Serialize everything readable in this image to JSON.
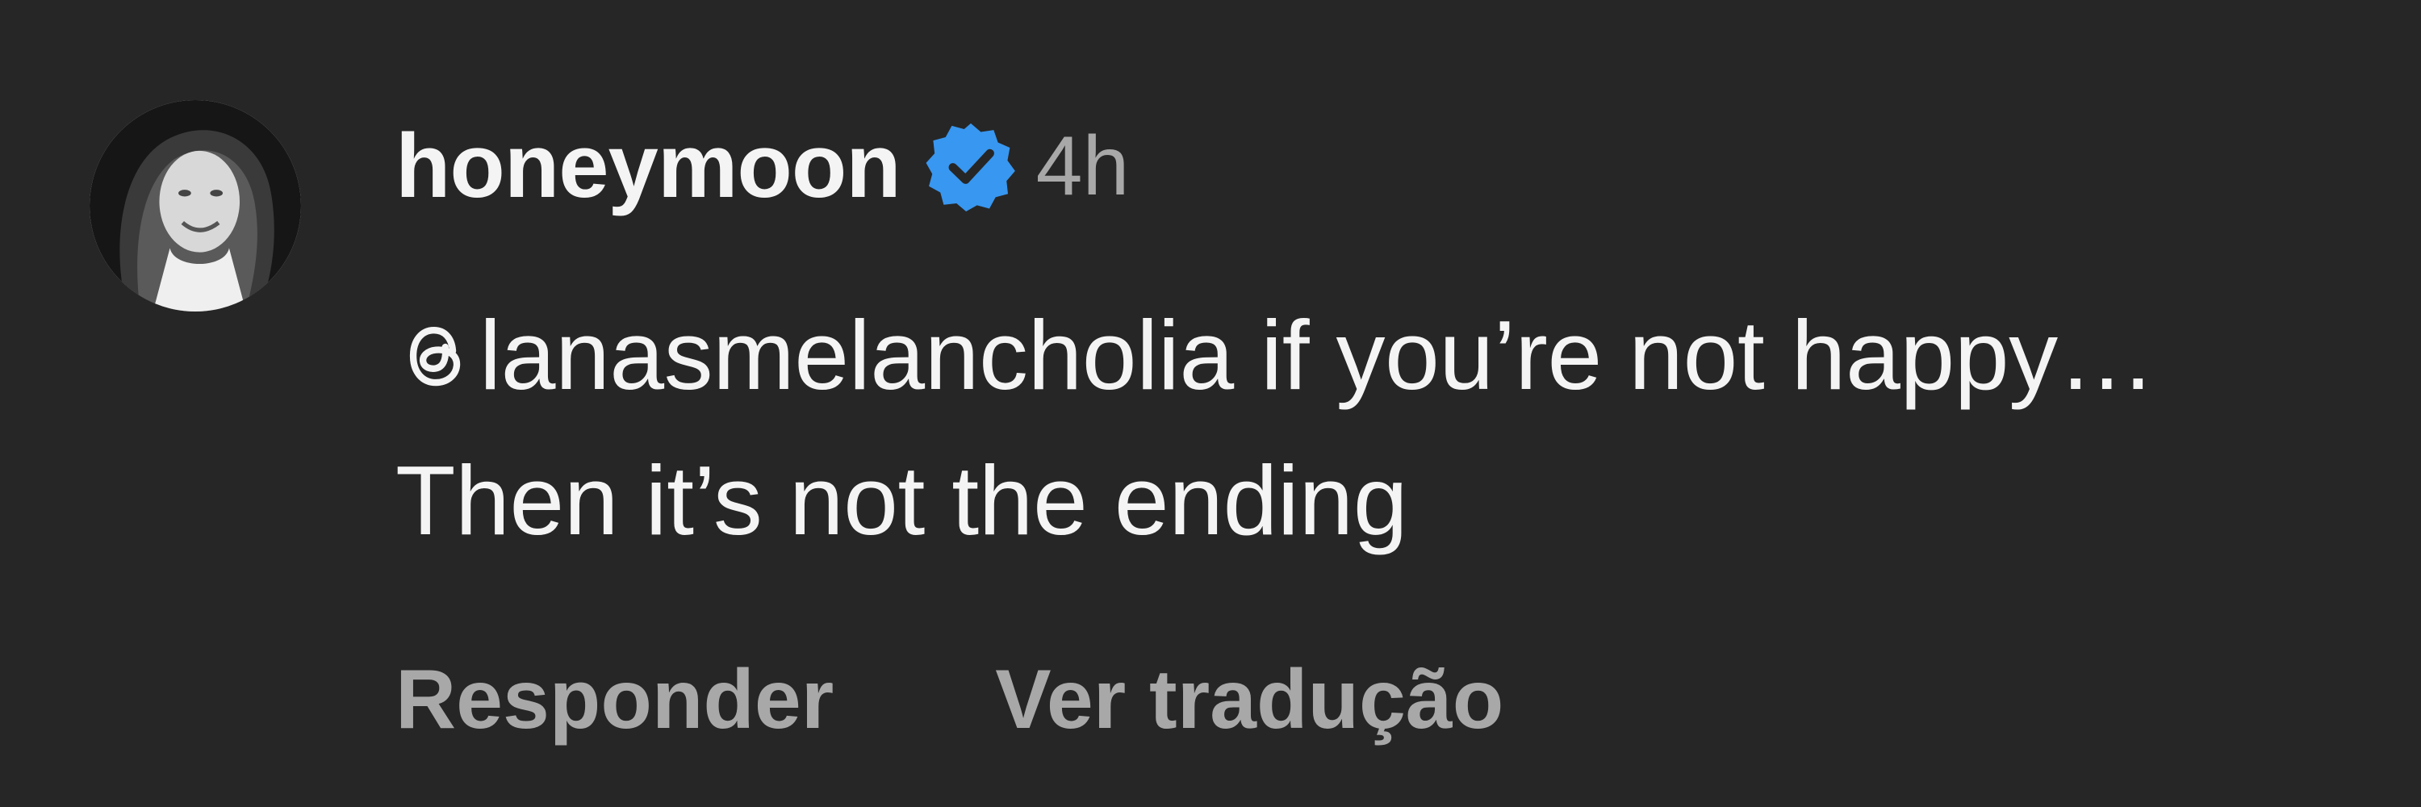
{
  "comment": {
    "author": {
      "username": "honeymoon",
      "verified": true,
      "avatar_icon": "profile-photo"
    },
    "time_ago": "4h",
    "mention": "lanasmelancholia",
    "mention_icon": "threads-icon",
    "text": "if you’re not happy… Then it’s not the ending",
    "actions": {
      "reply_label": "Responder",
      "translate_label": "Ver tradução"
    }
  },
  "colors": {
    "background": "#262626",
    "primary_text": "#f4f4f4",
    "secondary_text": "#a8a8a8",
    "verified_badge": "#3897f0"
  }
}
